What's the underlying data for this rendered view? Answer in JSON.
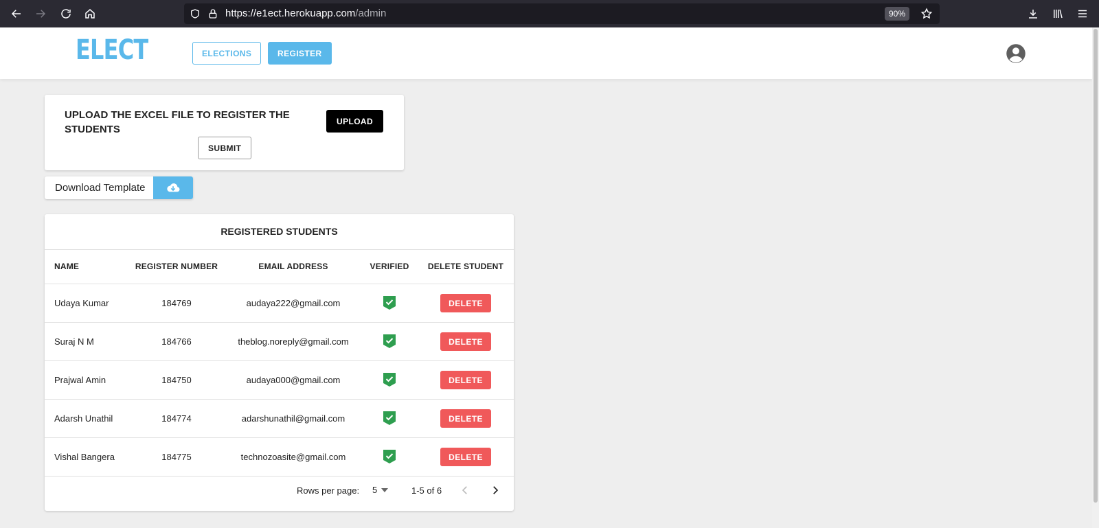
{
  "browser": {
    "url_host": "https://e1ect.herokuapp.com",
    "url_path": "/admin",
    "zoom": "90%"
  },
  "header": {
    "logo": "ELECT",
    "nav": {
      "elections_label": "ELECTIONS",
      "register_label": "REGISTER"
    }
  },
  "upload": {
    "title": "UPLOAD THE EXCEL FILE TO REGISTER THE STUDENTS",
    "upload_label": "UPLOAD",
    "submit_label": "SUBMIT"
  },
  "download": {
    "label": "Download Template"
  },
  "table": {
    "title": "REGISTERED STUDENTS",
    "columns": {
      "name": "NAME",
      "register_number": "REGISTER NUMBER",
      "email": "EMAIL ADDRESS",
      "verified": "VERIFIED",
      "delete": "DELETE STUDENT"
    },
    "delete_label": "DELETE",
    "rows": [
      {
        "name": "Udaya Kumar",
        "register_number": "184769",
        "email": "audaya222@gmail.com",
        "verified": true
      },
      {
        "name": "Suraj N M",
        "register_number": "184766",
        "email": "theblog.noreply@gmail.com",
        "verified": true
      },
      {
        "name": "Prajwal Amin",
        "register_number": "184750",
        "email": "audaya000@gmail.com",
        "verified": true
      },
      {
        "name": "Adarsh Unathil",
        "register_number": "184774",
        "email": "adarshunathil@gmail.com",
        "verified": true
      },
      {
        "name": "Vishal Bangera",
        "register_number": "184775",
        "email": "technozoasite@gmail.com",
        "verified": true
      }
    ],
    "pagination": {
      "rows_per_page_label": "Rows per page:",
      "rows_per_page_value": "5",
      "range": "1-5 of 6"
    }
  },
  "colors": {
    "accent": "#5ab8ea",
    "delete": "#f0595a",
    "verified": "#2e9e4f"
  }
}
